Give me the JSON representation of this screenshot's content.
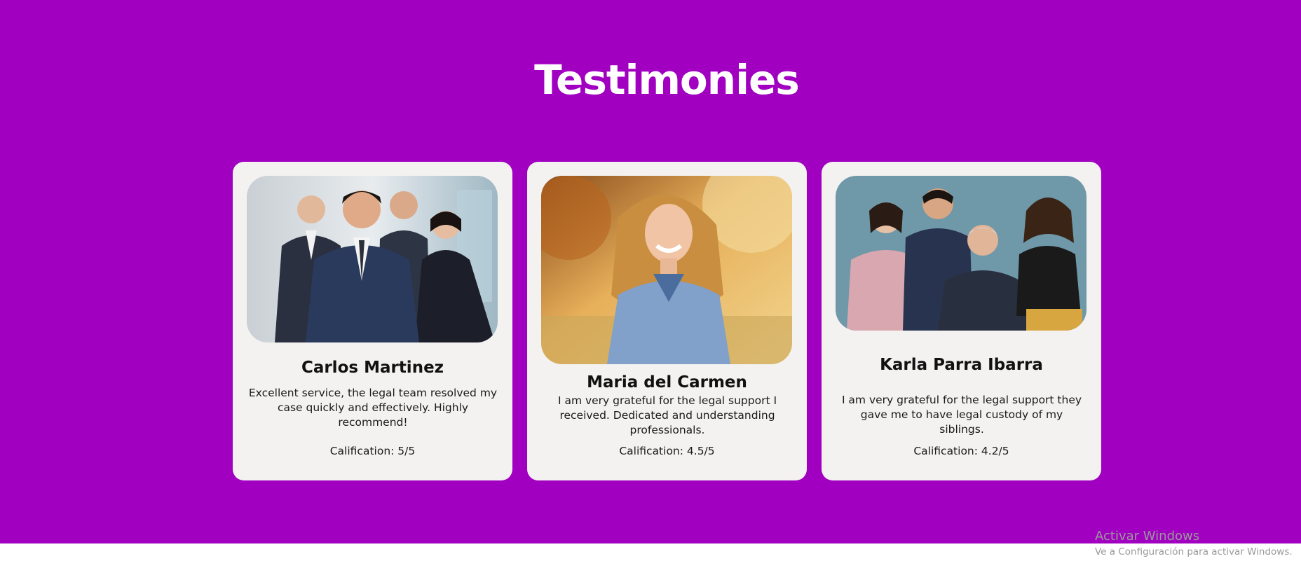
{
  "section": {
    "title": "Testimonies",
    "background": "#a100c1"
  },
  "testimonials": [
    {
      "name": "Carlos Martinez",
      "text": "Excellent service, the legal team resolved my case quickly and effectively. Highly recommend!",
      "rating": "Calification: 5/5"
    },
    {
      "name": "Maria del Carmen",
      "text": "I am very grateful for the legal support I received. Dedicated and understanding professionals.",
      "rating": "Calification: 4.5/5"
    },
    {
      "name": "Karla Parra Ibarra",
      "text": "I am very grateful for the legal support they gave me to have legal custody of my siblings.",
      "rating": "Calification: 4.2/5"
    }
  ],
  "os_watermark": {
    "title": "Activar Windows",
    "subtitle": "Ve a Configuración para activar Windows."
  }
}
